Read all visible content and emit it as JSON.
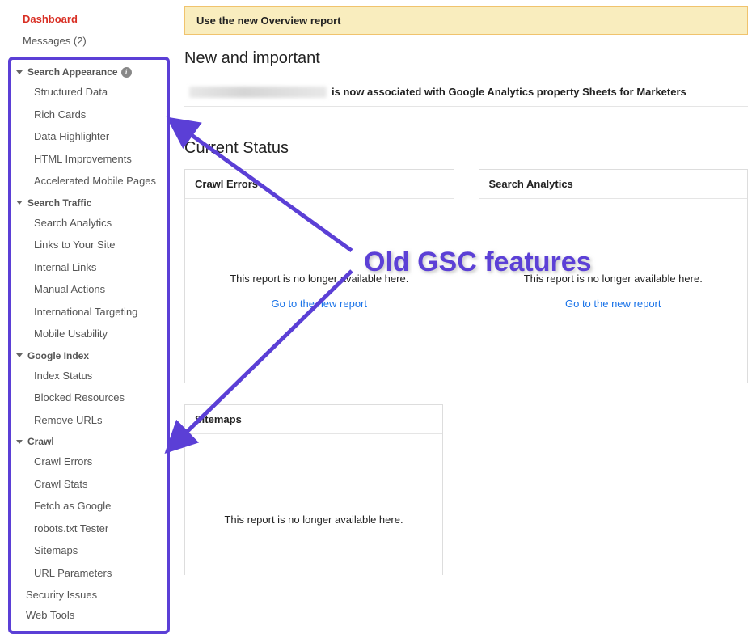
{
  "sidebar": {
    "dashboard": "Dashboard",
    "messages": "Messages (2)",
    "sections": {
      "searchAppearance": {
        "label": "Search Appearance",
        "items": [
          "Structured Data",
          "Rich Cards",
          "Data Highlighter",
          "HTML Improvements",
          "Accelerated Mobile Pages"
        ]
      },
      "searchTraffic": {
        "label": "Search Traffic",
        "items": [
          "Search Analytics",
          "Links to Your Site",
          "Internal Links",
          "Manual Actions",
          "International Targeting",
          "Mobile Usability"
        ]
      },
      "googleIndex": {
        "label": "Google Index",
        "items": [
          "Index Status",
          "Blocked Resources",
          "Remove URLs"
        ]
      },
      "crawl": {
        "label": "Crawl",
        "items": [
          "Crawl Errors",
          "Crawl Stats",
          "Fetch as Google",
          "robots.txt Tester",
          "Sitemaps",
          "URL Parameters"
        ]
      }
    },
    "securityIssues": "Security Issues",
    "webTools": "Web Tools"
  },
  "main": {
    "banner": "Use the new Overview report",
    "newImportant": {
      "title": "New and important",
      "noticeText": "is now associated with Google Analytics property Sheets for Marketers"
    },
    "currentStatus": {
      "title": "Current Status",
      "cards": {
        "crawlErrors": {
          "title": "Crawl Errors",
          "msg": "This report is no longer available here.",
          "link": "Go to the new report"
        },
        "searchAnalytics": {
          "title": "Search Analytics",
          "msg": "This report is no longer available here.",
          "link": "Go to the new report"
        },
        "sitemaps": {
          "title": "Sitemaps",
          "msg": "This report is no longer available here."
        }
      }
    }
  },
  "annotation": {
    "label": "Old GSC features"
  },
  "colors": {
    "accent": "#5b3fd6",
    "danger": "#d93025",
    "link": "#1a73e8",
    "bannerBg": "#f9edbe",
    "bannerBorder": "#f0c36d"
  }
}
